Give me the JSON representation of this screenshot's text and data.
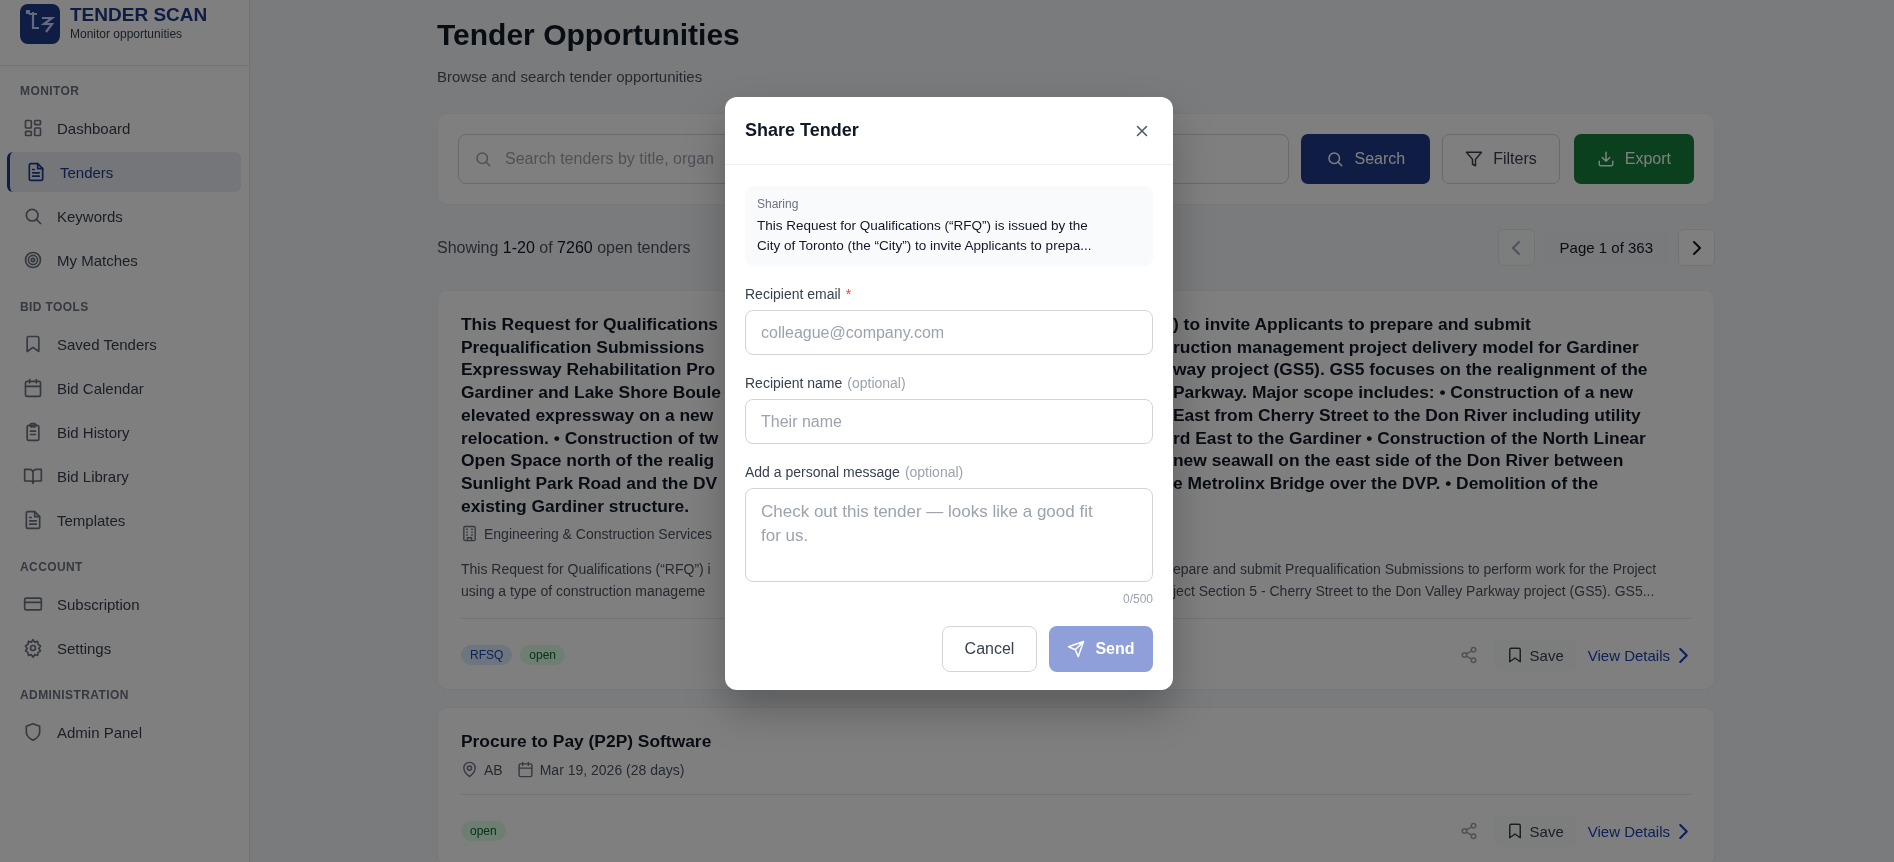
{
  "brand": {
    "title": "TENDER SCAN",
    "subtitle": "Monitor opportunities"
  },
  "sidebar": {
    "sections": [
      {
        "heading": "MONITOR",
        "items": [
          {
            "label": "Dashboard",
            "selected": false
          },
          {
            "label": "Tenders",
            "selected": true
          },
          {
            "label": "Keywords",
            "selected": false
          },
          {
            "label": "My Matches",
            "selected": false
          }
        ]
      },
      {
        "heading": "BID TOOLS",
        "items": [
          {
            "label": "Saved Tenders",
            "selected": false
          },
          {
            "label": "Bid Calendar",
            "selected": false
          },
          {
            "label": "Bid History",
            "selected": false
          },
          {
            "label": "Bid Library",
            "selected": false
          },
          {
            "label": "Templates",
            "selected": false
          }
        ]
      },
      {
        "heading": "ACCOUNT",
        "items": [
          {
            "label": "Subscription",
            "selected": false
          },
          {
            "label": "Settings",
            "selected": false
          }
        ]
      },
      {
        "heading": "ADMINISTRATION",
        "items": [
          {
            "label": "Admin Panel",
            "selected": false
          }
        ]
      }
    ]
  },
  "page": {
    "title": "Tender Opportunities",
    "subtitle": "Browse and search tender opportunities"
  },
  "search": {
    "placeholder": "Search tenders by title, organ",
    "buttons": [
      {
        "label": "Search",
        "kind": "primary"
      },
      {
        "label": "Filters",
        "kind": "outline"
      },
      {
        "label": "Export",
        "kind": "export"
      }
    ]
  },
  "results": {
    "prefix": "Showing",
    "range": "1-20",
    "of": "of",
    "total": "7260",
    "suffix": "open tenders"
  },
  "pagination": {
    "label": "Page 1 of 363",
    "prev_disabled": true,
    "next_disabled": false
  },
  "tenders": [
    {
      "title_lines": [
        {
          "left": "This Request for Qualifications",
          "right": ") to invite Applicants to prepare and submit"
        },
        {
          "left": "Prequalification Submissions",
          "right": "ruction management project delivery model for Gardiner"
        },
        {
          "left": "Expressway Rehabilitation Pro",
          "right": "way project (GS5). GS5 focuses on the realignment of the"
        },
        {
          "left": "Gardiner and Lake Shore Boule",
          "right": "Parkway. Major scope includes: • Construction of a new"
        },
        {
          "left": "elevated expressway on a new",
          "right": "East from Cherry Street to the Don River including utility"
        },
        {
          "left": "relocation. • Construction of tw",
          "right": "rd East to the Gardiner • Construction of the North Linear"
        },
        {
          "left": "Open Space north of the realig",
          "right": "new seawall on the east side of the Don River between"
        },
        {
          "left": "Sunlight Park Road and the DV",
          "right": "e Metrolinx Bridge over the DVP. • Demolition of the"
        },
        {
          "left": "existing Gardiner structure."
        }
      ],
      "meta": [
        {
          "kind": "organization",
          "text": "Engineering & Construction Services"
        }
      ],
      "description_lines": [
        {
          "left": "This Request for Qualifications (“RFQ”) i",
          "right": "epare and submit Prequalification Submissions to perform work for the Project"
        },
        {
          "left": "using a type of construction manageme",
          "right": "ject Section 5 - Cherry Street to the Don Valley Parkway project (GS5). GS5..."
        }
      ],
      "tags": [
        {
          "label": "RFSQ",
          "kind": "type"
        },
        {
          "label": "open",
          "kind": "status"
        }
      ],
      "save": "Save",
      "details": "View Details"
    },
    {
      "title_lines": [
        {
          "left": "Procure to Pay (P2P) Software"
        }
      ],
      "meta": [
        {
          "kind": "location",
          "text": "AB"
        },
        {
          "kind": "date",
          "text": "Mar 19, 2026 (28 days)"
        }
      ],
      "tags": [
        {
          "label": "open",
          "kind": "status"
        }
      ],
      "save": "Save",
      "details": "View Details"
    }
  ],
  "modal": {
    "title": "Share Tender",
    "sharing_label": "Sharing",
    "sharing_lines": [
      "This Request for Qualifications (“RFQ”) is issued by the",
      "City of Toronto (the “City”) to invite Applicants to prepa..."
    ],
    "fields": [
      {
        "label": "Recipient email",
        "mark": "*",
        "placeholder": "colleague@company.com",
        "kind": "input"
      },
      {
        "label": "Recipient name",
        "note": "(optional)",
        "placeholder": "Their name",
        "kind": "input"
      },
      {
        "label": "Add a personal message",
        "note": "(optional)",
        "placeholder": "Check out this tender — looks like a good fit for us.",
        "kind": "textarea",
        "counter": "0/500"
      }
    ],
    "cancel": "Cancel",
    "send": {
      "label": "Send",
      "disabled": true
    }
  }
}
